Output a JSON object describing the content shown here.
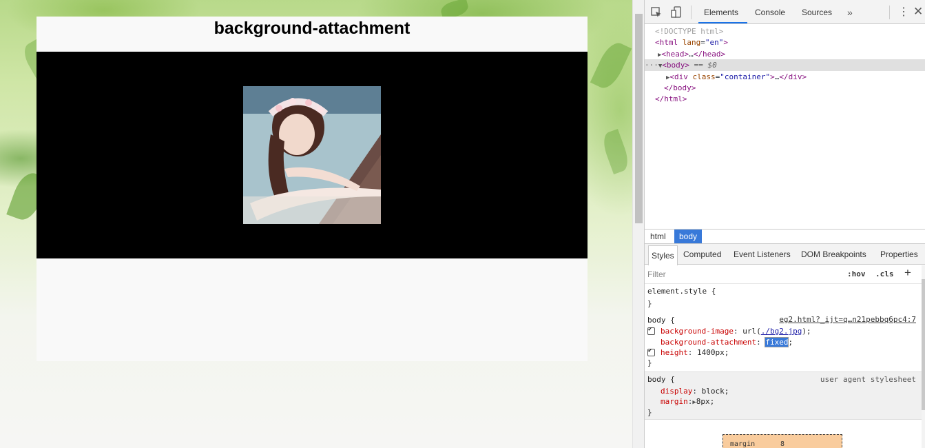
{
  "page": {
    "heading": "background-attachment"
  },
  "devtools": {
    "tabs": [
      "Elements",
      "Console",
      "Sources"
    ],
    "more_tabs": "»",
    "dom": {
      "doctype": "<!DOCTYPE html>",
      "html_open_tag": "html",
      "html_attr_name": "lang",
      "html_attr_value": "\"en\"",
      "head_collapsed": "head",
      "head_ellipsis": "…",
      "body_tag": "body",
      "body_marker": "== $0",
      "div_tag": "div",
      "div_attr_name": "class",
      "div_attr_value": "\"container\"",
      "body_close": "/body",
      "html_close": "/html"
    },
    "breadcrumbs": [
      "html",
      "body"
    ],
    "sub_tabs": [
      "Styles",
      "Computed",
      "Event Listeners",
      "DOM Breakpoints",
      "Properties"
    ],
    "filter_placeholder": "Filter",
    "hov": ":hov",
    "cls": ".cls",
    "add_rule": "+",
    "styles": {
      "element_style": "element.style {",
      "close_brace": "}",
      "body_selector": "body {",
      "source_link": "eg2.html?_ijt=q…n21pebbq6pc4:7",
      "rules": [
        {
          "prop": "background-image",
          "pre": "url(",
          "link": "./bg2.jpg",
          "post": ");",
          "checked": true
        },
        {
          "prop": "background-attachment",
          "value": "fixed",
          "post": ";",
          "checked": false
        },
        {
          "prop": "height",
          "value": "1400px;",
          "checked": true
        }
      ],
      "ua_selector": "body {",
      "ua_label": "user agent stylesheet",
      "ua_rules": [
        {
          "prop": "display",
          "value": "block;"
        },
        {
          "prop": "margin",
          "value": "8px;"
        }
      ]
    },
    "box_model": {
      "label": "margin",
      "value": "8"
    }
  }
}
